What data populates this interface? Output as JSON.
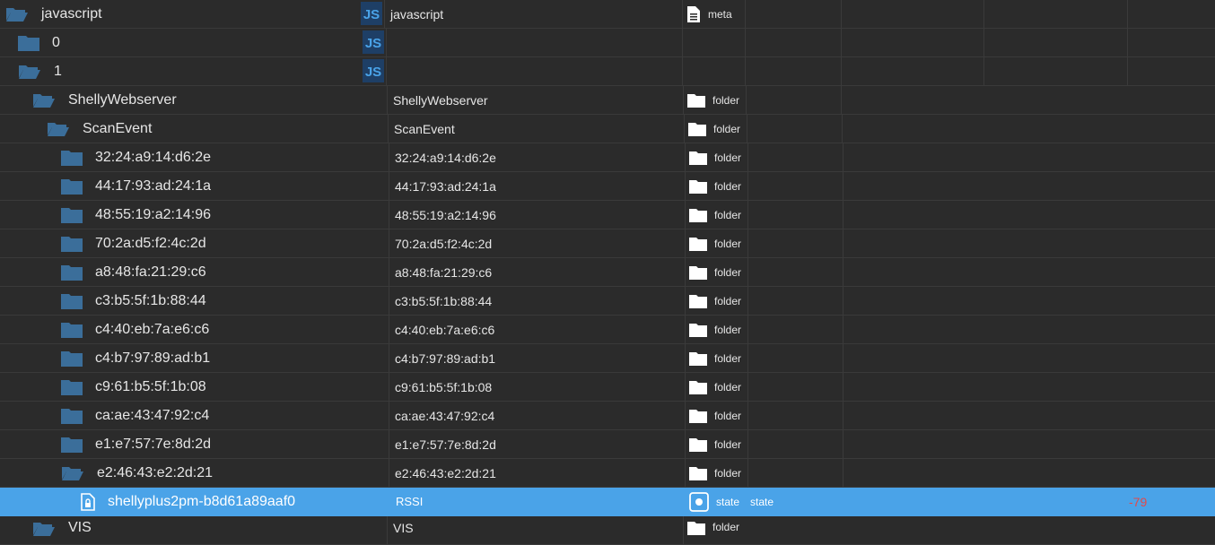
{
  "rows": [
    {
      "name": "javascript",
      "id": "javascript",
      "type": "meta",
      "icon": "folder-open-icon",
      "js": true
    },
    {
      "name": "0",
      "id": "",
      "type": "",
      "icon": "folder-icon",
      "js": true
    },
    {
      "name": "1",
      "id": "",
      "type": "",
      "icon": "folder-open-icon",
      "js": true
    },
    {
      "name": "ShellyWebserver",
      "id": "ShellyWebserver",
      "type": "folder",
      "icon": "folder-open-icon"
    },
    {
      "name": "ScanEvent",
      "id": "ScanEvent",
      "type": "folder",
      "icon": "folder-open-icon"
    },
    {
      "name": "32:24:a9:14:d6:2e",
      "id": "32:24:a9:14:d6:2e",
      "type": "folder",
      "icon": "folder-icon"
    },
    {
      "name": "44:17:93:ad:24:1a",
      "id": "44:17:93:ad:24:1a",
      "type": "folder",
      "icon": "folder-icon"
    },
    {
      "name": "48:55:19:a2:14:96",
      "id": "48:55:19:a2:14:96",
      "type": "folder",
      "icon": "folder-icon"
    },
    {
      "name": "70:2a:d5:f2:4c:2d",
      "id": "70:2a:d5:f2:4c:2d",
      "type": "folder",
      "icon": "folder-icon"
    },
    {
      "name": "a8:48:fa:21:29:c6",
      "id": "a8:48:fa:21:29:c6",
      "type": "folder",
      "icon": "folder-icon"
    },
    {
      "name": "c3:b5:5f:1b:88:44",
      "id": "c3:b5:5f:1b:88:44",
      "type": "folder",
      "icon": "folder-icon"
    },
    {
      "name": "c4:40:eb:7a:e6:c6",
      "id": "c4:40:eb:7a:e6:c6",
      "type": "folder",
      "icon": "folder-icon"
    },
    {
      "name": "c4:b7:97:89:ad:b1",
      "id": "c4:b7:97:89:ad:b1",
      "type": "folder",
      "icon": "folder-icon"
    },
    {
      "name": "c9:61:b5:5f:1b:08",
      "id": "c9:61:b5:5f:1b:08",
      "type": "folder",
      "icon": "folder-icon"
    },
    {
      "name": "ca:ae:43:47:92:c4",
      "id": "ca:ae:43:47:92:c4",
      "type": "folder",
      "icon": "folder-icon"
    },
    {
      "name": "e1:e7:57:7e:8d:2d",
      "id": "e1:e7:57:7e:8d:2d",
      "type": "folder",
      "icon": "folder-icon"
    },
    {
      "name": "e2:46:43:e2:2d:21",
      "id": "e2:46:43:e2:2d:21",
      "type": "folder",
      "icon": "folder-open-icon"
    },
    {
      "name": "shellyplus2pm-b8d61a89aaf0",
      "id": "RSSI",
      "type": "state",
      "role": "state",
      "value": "-79",
      "icon": "state-file-icon",
      "selected": true
    },
    {
      "name": "VIS",
      "id": "VIS",
      "type": "folder",
      "icon": "folder-open-icon"
    }
  ],
  "colors": {
    "folder": "#3b6e9a",
    "selected_bg": "#4aa3e8",
    "value": "#e24a4a",
    "js_bg": "#1e3f66",
    "js_fg": "#4aa3e8"
  }
}
